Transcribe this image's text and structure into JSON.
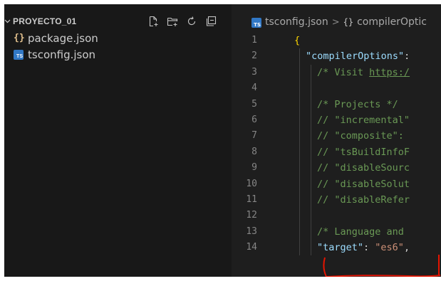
{
  "explorer": {
    "folder_name": "PROYECTO_01",
    "actions": [
      {
        "name": "new-file-icon"
      },
      {
        "name": "new-folder-icon"
      },
      {
        "name": "refresh-icon"
      },
      {
        "name": "collapse-all-icon"
      }
    ],
    "files": [
      {
        "label": "package.json",
        "icon": "json-file-icon",
        "glyph": "{}"
      },
      {
        "label": "tsconfig.json",
        "icon": "typescript-file-icon",
        "glyph": "TS"
      }
    ]
  },
  "editor": {
    "breadcrumb": {
      "file_icon_glyph": "TS",
      "file": "tsconfig.json",
      "separator": ">",
      "symbol_glyph": "{}",
      "symbol": "compilerOptic"
    },
    "lines": [
      {
        "n": "1",
        "indent": 0,
        "tokens": [
          [
            "brace",
            "{"
          ]
        ]
      },
      {
        "n": "2",
        "indent": 1,
        "tokens": [
          [
            "key",
            "\"compilerOptions\""
          ],
          [
            "punc",
            ":"
          ]
        ]
      },
      {
        "n": "3",
        "indent": 2,
        "tokens": [
          [
            "com",
            "/* Visit "
          ],
          [
            "link",
            "https:/"
          ]
        ]
      },
      {
        "n": "4",
        "indent": 2,
        "tokens": []
      },
      {
        "n": "5",
        "indent": 2,
        "tokens": [
          [
            "com",
            "/* Projects */"
          ]
        ]
      },
      {
        "n": "6",
        "indent": 2,
        "tokens": [
          [
            "com",
            "// \"incremental\""
          ]
        ]
      },
      {
        "n": "7",
        "indent": 2,
        "tokens": [
          [
            "com",
            "// \"composite\": "
          ]
        ]
      },
      {
        "n": "8",
        "indent": 2,
        "tokens": [
          [
            "com",
            "// \"tsBuildInfoF"
          ]
        ]
      },
      {
        "n": "9",
        "indent": 2,
        "tokens": [
          [
            "com",
            "// \"disableSourc"
          ]
        ]
      },
      {
        "n": "10",
        "indent": 2,
        "tokens": [
          [
            "com",
            "// \"disableSolut"
          ]
        ]
      },
      {
        "n": "11",
        "indent": 2,
        "tokens": [
          [
            "com",
            "// \"disableRefer"
          ]
        ]
      },
      {
        "n": "12",
        "indent": 2,
        "tokens": []
      },
      {
        "n": "13",
        "indent": 2,
        "tokens": [
          [
            "com",
            "/* Language and "
          ]
        ]
      },
      {
        "n": "14",
        "indent": 2,
        "tokens": [
          [
            "key",
            "\"target\""
          ],
          [
            "punc",
            ": "
          ],
          [
            "str",
            "\"es6\""
          ],
          [
            "punc",
            ","
          ]
        ]
      }
    ]
  },
  "colors": {
    "sidebar_bg": "#181818",
    "editor_bg": "#1e1e1e",
    "annotation_red": "#e51400"
  }
}
